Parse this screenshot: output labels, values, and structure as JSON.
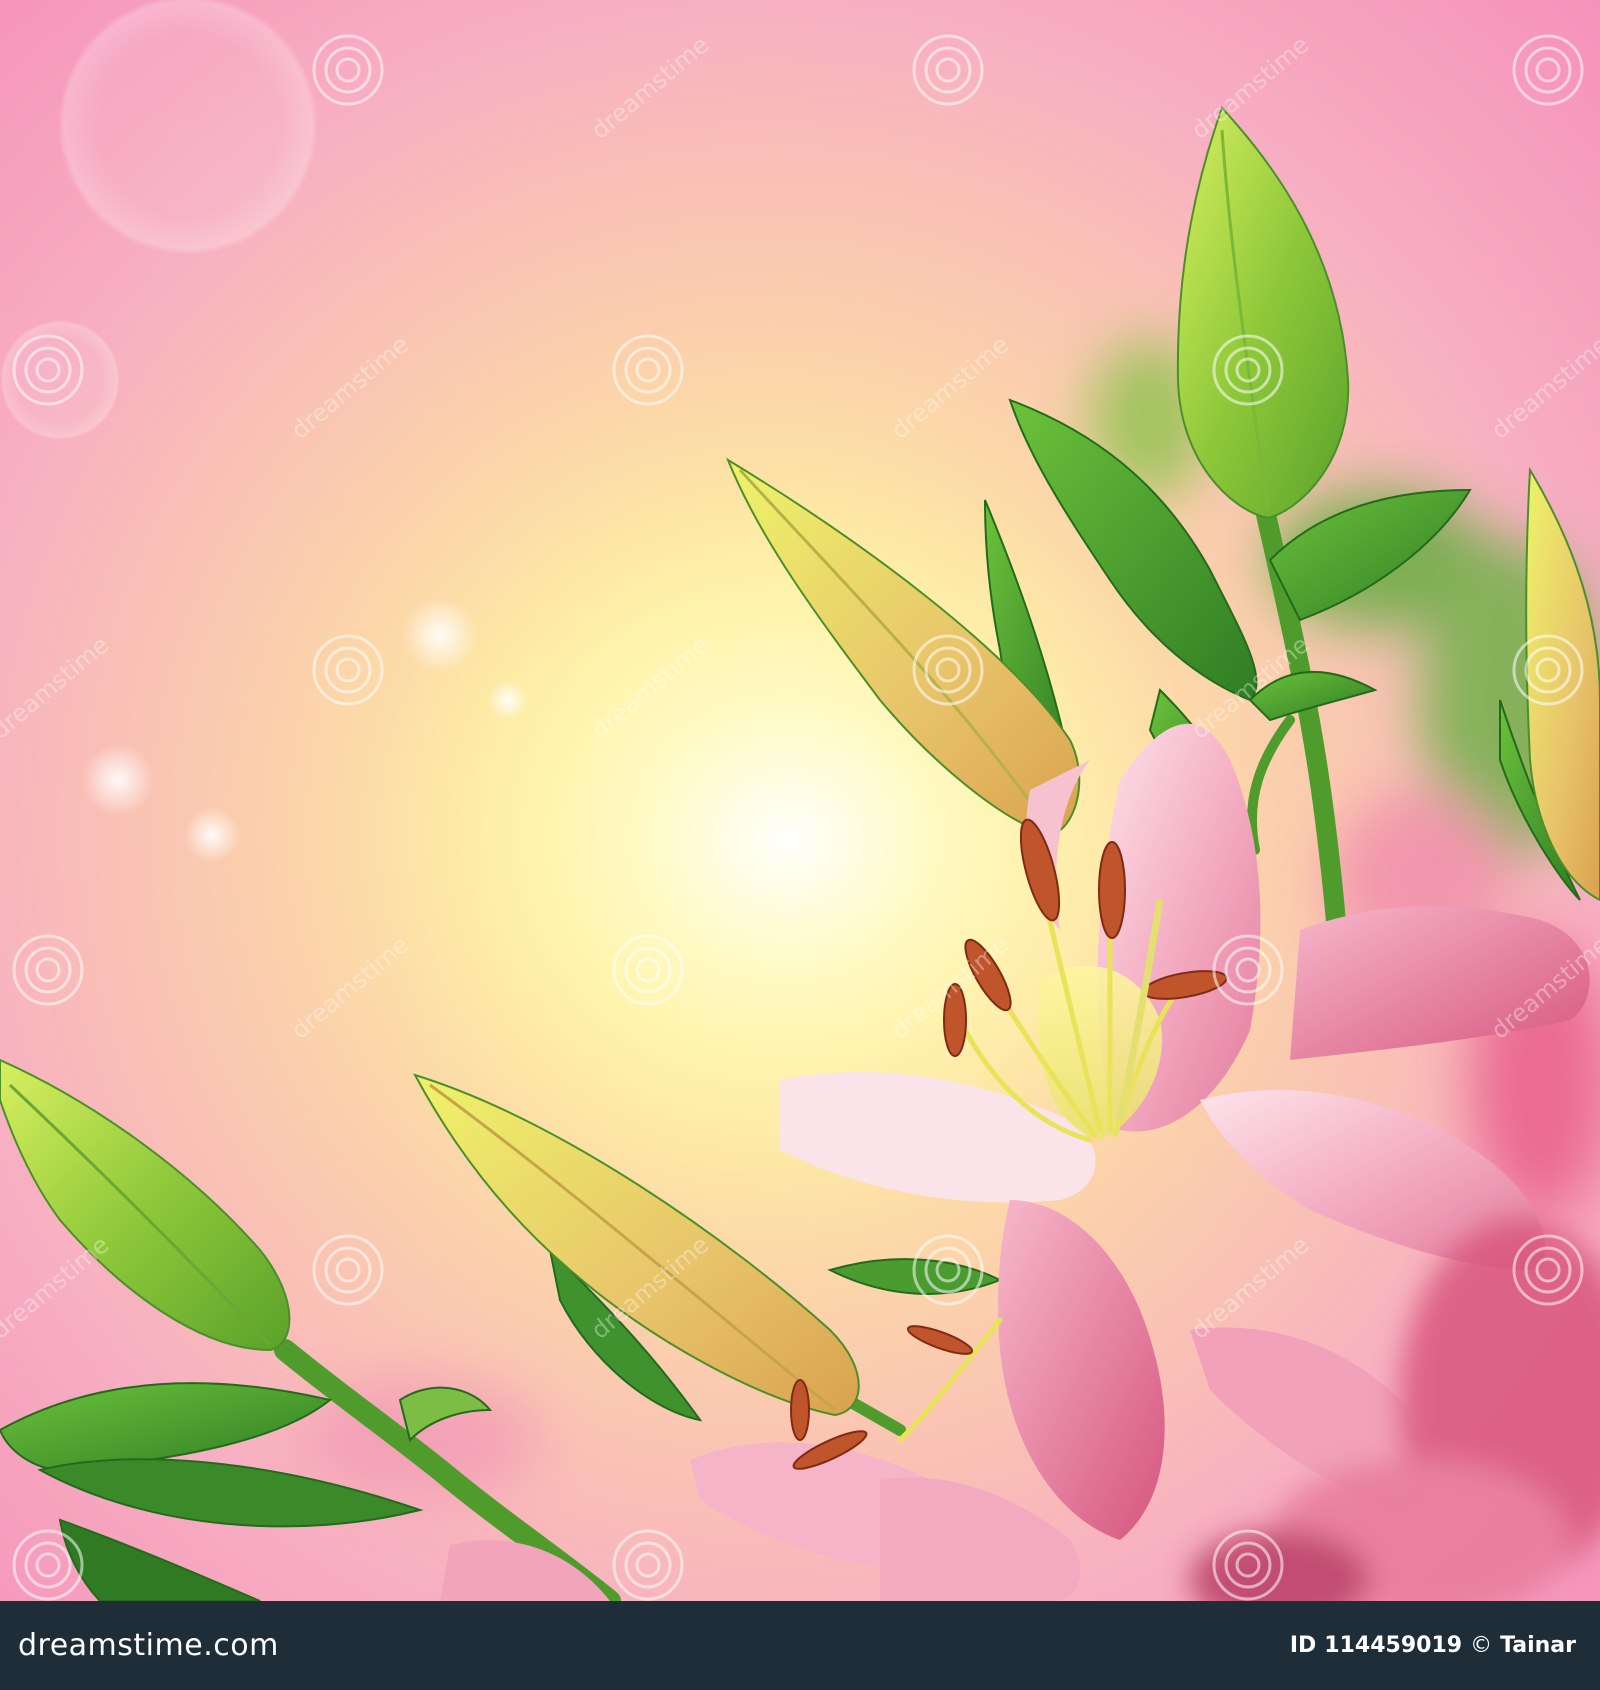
{
  "footer": {
    "brand_text": "dreamstime.com",
    "id_prefix": "ID",
    "image_id": "114459019",
    "copyright_symbol": "©",
    "author": "Tainar"
  },
  "watermark": {
    "text": "dreamstime",
    "icon": "spiral-logo-icon"
  },
  "colors": {
    "sky_pink": "#f6a5bd",
    "sky_glow": "#fff6b4",
    "petal_pink": "#f2a2bc",
    "leaf_green": "#3f9a2e",
    "bud_green": "#a6d63a",
    "footer_bg": "#1f2d38"
  },
  "image_description_tags": [
    "pink-lily",
    "flower-buds",
    "green-leaves",
    "bokeh"
  ]
}
